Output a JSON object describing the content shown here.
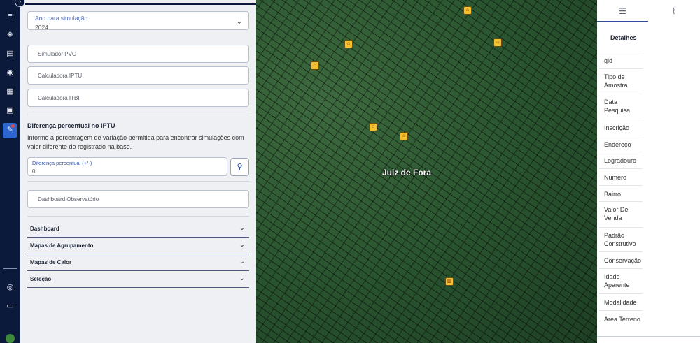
{
  "panel": {
    "year_select": {
      "label": "Ano para simulação",
      "value": "2024"
    },
    "buttons": {
      "pvg": "Simulador PVG",
      "iptu": "Calculadora IPTU",
      "itbi": "Calculadora ITBI",
      "dashboard_obs": "Dashboard Observatório"
    },
    "diff_section": {
      "title": "Diferença percentual no IPTU",
      "text": "Informe a porcentagem de variação permitida para encontrar simulações com valor diferente do registrado na base.",
      "input_label": "Diferença percentual (+/-)",
      "input_value": "0"
    },
    "accordions": [
      "Dashboard",
      "Mapas de Agrupamento",
      "Mapas de Calor",
      "Seleção"
    ]
  },
  "map": {
    "label": "Juiz de Fora"
  },
  "details": {
    "title": "Detalhes",
    "attributes": [
      "gid",
      "Tipo de Amostra",
      "Data Pesquisa",
      "Inscrição",
      "Endereço",
      "Logradouro",
      "Numero",
      "Bairro",
      "Valor De Venda",
      "Padrão Construtivo",
      "Conservação",
      "Idade Aparente",
      "Modalidade",
      "Área Terreno"
    ]
  },
  "icons": {
    "rail": [
      "menu-icon",
      "layers-icon",
      "book-icon",
      "globe-icon",
      "grid-icon",
      "map-icon",
      "user-edit-icon",
      "user-circle-icon",
      "chat-icon"
    ],
    "tabs": [
      "list-icon",
      "paperclip-icon"
    ]
  }
}
